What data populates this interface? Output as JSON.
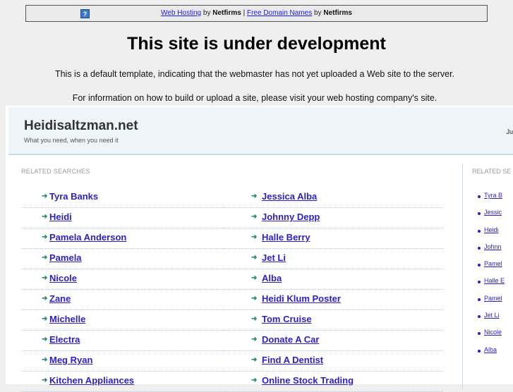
{
  "topbar": {
    "help_icon": "?",
    "link1": "Web Hosting",
    "by1": "by",
    "brand1": "Netfirms",
    "sep": "|",
    "link2": "Free Domain Names",
    "by2": "by",
    "brand2": "Netfirms"
  },
  "title": "This site is under development",
  "para1": "This is a default template, indicating that the webmaster has not yet uploaded a Web site to the server.",
  "para2": "For information on how to build or upload a site, please visit your web hosting company's site.",
  "site": {
    "name": "Heidisaltzman.net",
    "tagline": "What you need, when you need it",
    "right_text": "Ju"
  },
  "related_label": "RELATED SEARCHES",
  "col1": [
    "Tyra Banks",
    "Heidi",
    "Pamela Anderson",
    "Pamela",
    "Nicole",
    "Zane",
    "Michelle",
    "Electra",
    "Meg Ryan",
    "Kitchen Appliances"
  ],
  "col2": [
    "Jessica Alba",
    "Johnny Depp",
    "Halle Berry",
    "Jet Li",
    "Alba",
    "Heidi Klum Poster",
    "Tom Cruise",
    "Donate A Car",
    "Find A Dentist",
    "Online Stock Trading"
  ],
  "side_label": "RELATED SE",
  "side": [
    "Tyra B",
    "Jessic",
    "Heidi",
    "Johnn",
    "Pamel",
    "Halle E",
    "Pamel",
    "Jet Li",
    "Nicole",
    "Alba"
  ]
}
